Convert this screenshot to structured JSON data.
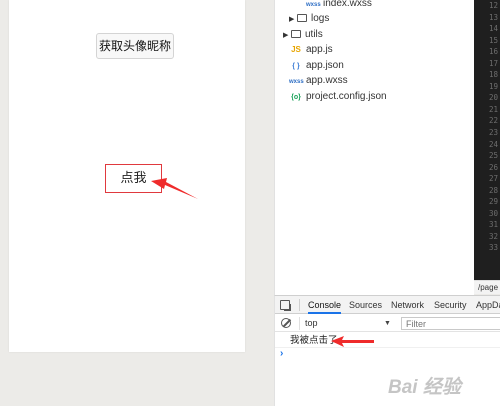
{
  "simulator": {
    "avatar_button_label": "获取头像昵称",
    "click_button_label": "点我"
  },
  "file_tree": {
    "items": [
      {
        "label": "index.wxss",
        "icon": "wxss-icon",
        "indent": 2
      },
      {
        "label": "logs",
        "icon": "folder-icon",
        "indent": 1,
        "caret": "▶"
      },
      {
        "label": "utils",
        "icon": "folder-icon",
        "indent": 0,
        "caret": "▶"
      },
      {
        "label": "app.js",
        "icon": "js-icon",
        "indent": 0
      },
      {
        "label": "app.json",
        "icon": "json-icon",
        "indent": 0
      },
      {
        "label": "app.wxss",
        "icon": "wxss-icon",
        "indent": 0
      },
      {
        "label": "project.config.json",
        "icon": "config-icon",
        "indent": 0
      }
    ]
  },
  "editor": {
    "line_numbers": [
      "12",
      "13",
      "14",
      "15",
      "16",
      "17",
      "18",
      "19",
      "20",
      "21",
      "22",
      "23",
      "24",
      "25",
      "26",
      "27",
      "28",
      "29",
      "30",
      "31",
      "32",
      "33"
    ],
    "path_text": "/page"
  },
  "devtools": {
    "tabs": [
      "Console",
      "Sources",
      "Network",
      "Security",
      "AppData"
    ],
    "active_tab": "Console",
    "context_value": "top",
    "filter_placeholder": "Filter",
    "log_message": "我被点击了",
    "prompt_symbol": "›"
  },
  "watermark_text": "Bai 经验",
  "colors": {
    "accent_red": "#e0393e",
    "devtools_blue": "#1a73e8",
    "editor_bg": "#1f1f1f"
  }
}
